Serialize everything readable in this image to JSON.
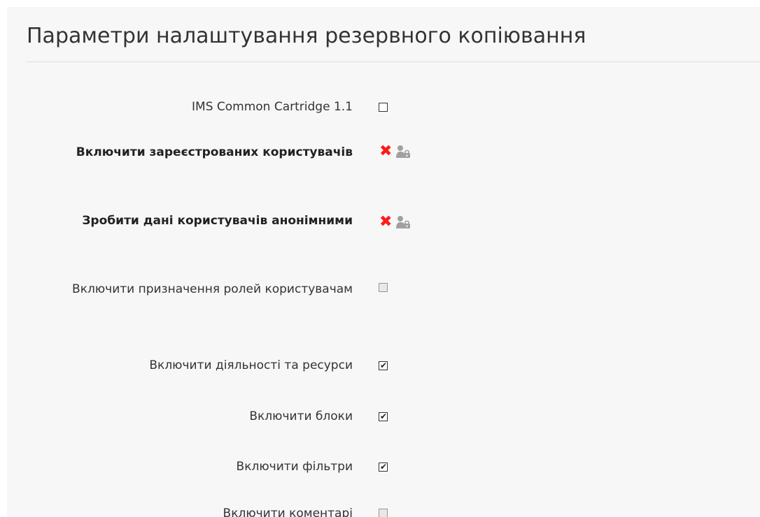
{
  "section": {
    "title": "Параметри налаштування резервного копіювання"
  },
  "settings": [
    {
      "label": "IMS Common Cartridge 1.1",
      "bold": false,
      "control": "checkbox",
      "checked": false,
      "disabled": false,
      "icon": "checkbox"
    },
    {
      "label": "Включити зареєстрованих користувачів",
      "bold": true,
      "control": "locked",
      "icons": [
        "cross-icon",
        "user-lock-icon"
      ]
    },
    {
      "label": "Зробити дані користувачів анонімними",
      "bold": true,
      "control": "locked",
      "icons": [
        "cross-icon",
        "user-lock-icon"
      ]
    },
    {
      "label": "Включити призначення ролей користувачам",
      "bold": false,
      "control": "checkbox",
      "checked": false,
      "disabled": true
    },
    {
      "label": "Включити діяльності та ресурси",
      "bold": false,
      "control": "checkbox",
      "checked": true,
      "disabled": false
    },
    {
      "label": "Включити блоки",
      "bold": false,
      "control": "checkbox",
      "checked": true,
      "disabled": false
    },
    {
      "label": "Включити фільтри",
      "bold": false,
      "control": "checkbox",
      "checked": true,
      "disabled": false
    },
    {
      "label": "Включити коментарі",
      "bold": false,
      "control": "checkbox",
      "checked": false,
      "disabled": true
    }
  ],
  "colors": {
    "cross": "#ff1a1a",
    "panel_background": "#f7f7f7",
    "lock_icon": "#a0a0a0"
  },
  "glyphs": {
    "checkmark": "✔",
    "cross": "✖"
  }
}
